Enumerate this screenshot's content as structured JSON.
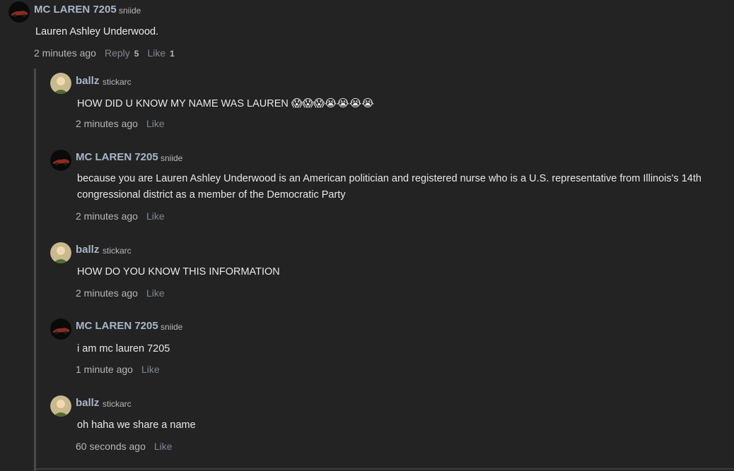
{
  "comments": [
    {
      "name": "MC LAREN 7205",
      "handle": "sniide",
      "body": "Lauren Ashley Underwood.",
      "time": "2 minutes ago",
      "reply": "Reply",
      "reply_count": "5",
      "like": "Like",
      "like_count": "1"
    },
    {
      "name": "ballz",
      "handle": "stickarc",
      "body": "HOW DID U KNOW MY NAME WAS LAUREN",
      "emojis": "😱😱😱😭😭😭😭",
      "time": "2 minutes ago",
      "like": "Like"
    },
    {
      "name": "MC LAREN 7205",
      "handle": "sniide",
      "body": "because you are Lauren Ashley Underwood is an American politician and registered nurse who is a U.S. representative from Illinois's 14th congressional district as a member of the Democratic Party",
      "time": "2 minutes ago",
      "like": "Like"
    },
    {
      "name": "ballz",
      "handle": "stickarc",
      "body": "HOW DO YOU KNOW THIS INFORMATION",
      "time": "2 minutes ago",
      "like": "Like"
    },
    {
      "name": "MC LAREN 7205",
      "handle": "sniide",
      "body": "i am mc lauren 7205",
      "time": "1 minute ago",
      "like": "Like"
    },
    {
      "name": "ballz",
      "handle": "stickarc",
      "body": "oh haha we share a name",
      "time": "60 seconds ago",
      "like": "Like"
    }
  ],
  "icons": {
    "car_avatar": "car-avatar-icon",
    "person_avatar": "person-avatar-icon"
  }
}
